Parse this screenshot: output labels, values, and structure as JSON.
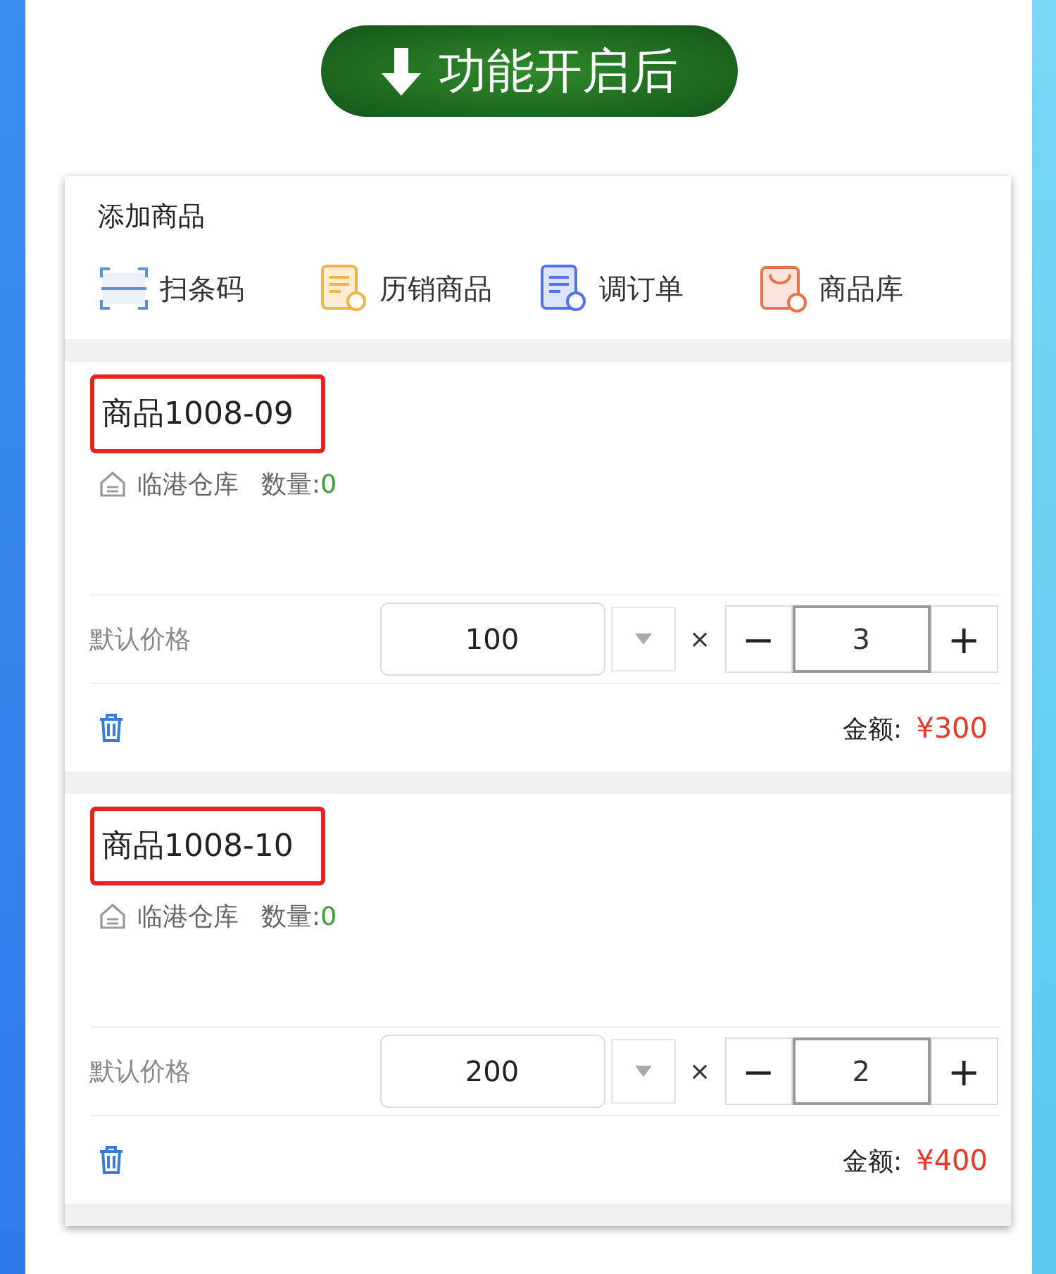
{
  "banner": {
    "label": "功能开启后"
  },
  "panel": {
    "title": "添加商品",
    "actions": [
      {
        "kind": "scan",
        "label": "扫条码",
        "color": "#5b8fe0"
      },
      {
        "kind": "history",
        "label": "历销商品",
        "color": "#f0b34a"
      },
      {
        "kind": "order",
        "label": "调订单",
        "color": "#4f74e8"
      },
      {
        "kind": "library",
        "label": "商品库",
        "color": "#e8734a"
      }
    ],
    "items": [
      {
        "name": "商品1008-09",
        "highlighted": true,
        "warehouse": "临港仓库",
        "qty_label": "数量:",
        "qty": "0",
        "price_label": "默认价格",
        "price": "100",
        "times": "×",
        "minus": "−",
        "count": "3",
        "plus": "+",
        "amount_label": "金额:",
        "amount": "¥300"
      },
      {
        "name": "商品1008-10",
        "highlighted": true,
        "warehouse": "临港仓库",
        "qty_label": "数量:",
        "qty": "0",
        "price_label": "默认价格",
        "price": "200",
        "times": "×",
        "minus": "−",
        "count": "2",
        "plus": "+",
        "amount_label": "金额:",
        "amount": "¥400"
      }
    ]
  }
}
